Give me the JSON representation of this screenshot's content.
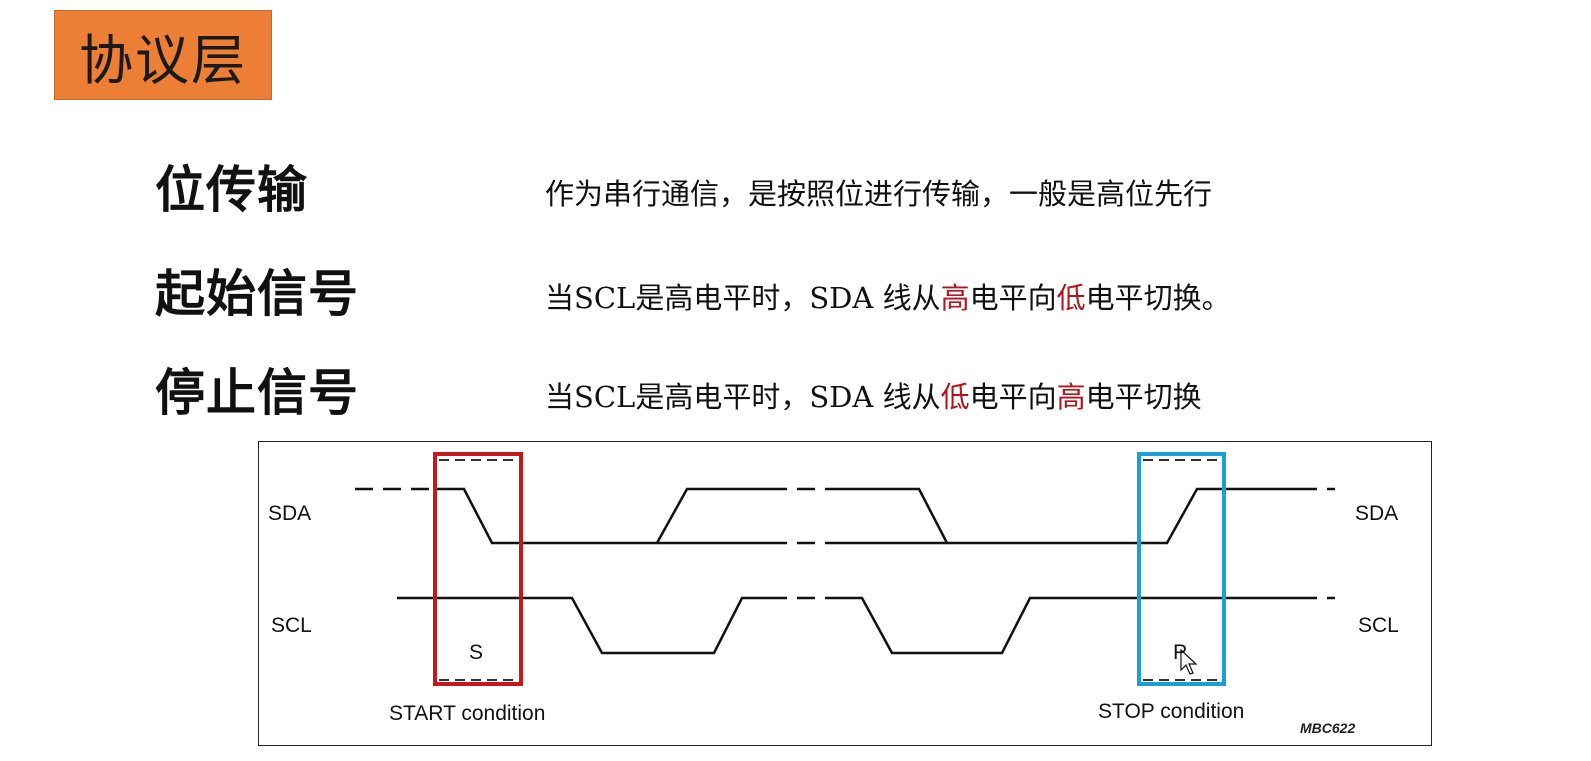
{
  "header": {
    "title": "协议层"
  },
  "rows": [
    {
      "term": "位传输",
      "desc": [
        {
          "t": "作为串行通信，是按照位进行传输，一般是高位先行",
          "red": false
        }
      ]
    },
    {
      "term": "起始信号",
      "desc": [
        {
          "t": "当SCL是高电平时，SDA 线从",
          "red": false
        },
        {
          "t": "高",
          "red": true
        },
        {
          "t": "电平向",
          "red": false
        },
        {
          "t": "低",
          "red": true
        },
        {
          "t": "电平切换。",
          "red": false
        }
      ]
    },
    {
      "term": "停止信号",
      "desc": [
        {
          "t": "当SCL是高电平时，SDA 线从",
          "red": false
        },
        {
          "t": "低",
          "red": true
        },
        {
          "t": "电平向",
          "red": false
        },
        {
          "t": "高",
          "red": true
        },
        {
          "t": "电平切换",
          "red": false
        }
      ]
    }
  ],
  "diagram": {
    "sda_label": "SDA",
    "scl_label": "SCL",
    "start_marker": "S",
    "stop_marker": "P",
    "start_caption": "START condition",
    "stop_caption": "STOP condition",
    "figure_code": "MBC622",
    "colors": {
      "start_box": "#c8161d",
      "stop_box": "#1aa0d8",
      "title_bg": "#ec7f35",
      "highlight": "#b0161d"
    }
  }
}
